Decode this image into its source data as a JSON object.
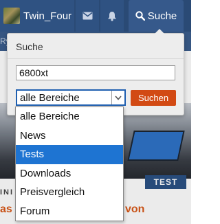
{
  "colors": {
    "navbar": "#2a4a75",
    "accent_blue": "#1e74d2",
    "submit_orange": "#d24a14",
    "headline_orange": "#d95a1a"
  },
  "navbar": {
    "username": "Twin_Four",
    "mail_icon": "envelope-icon",
    "bell_icon": "bell-icon",
    "search_icon": "magnifier-icon",
    "search_label": "Suche"
  },
  "background": {
    "strip_text": "Ry",
    "badge": "TEST",
    "headline_part1": "INI",
    "headline_part2": "as",
    "headline_part3": "von"
  },
  "search_popup": {
    "title": "Suche",
    "query": "6800xt",
    "scope_selected": "alle Bereiche",
    "submit_label": "Suchen",
    "scope_options": [
      {
        "label": "alle Bereiche",
        "selected": false
      },
      {
        "label": "News",
        "selected": false
      },
      {
        "label": "Tests",
        "selected": true
      },
      {
        "label": "Downloads",
        "selected": false
      },
      {
        "label": "Preisvergleich",
        "selected": false
      },
      {
        "label": "Forum",
        "selected": false
      }
    ]
  }
}
